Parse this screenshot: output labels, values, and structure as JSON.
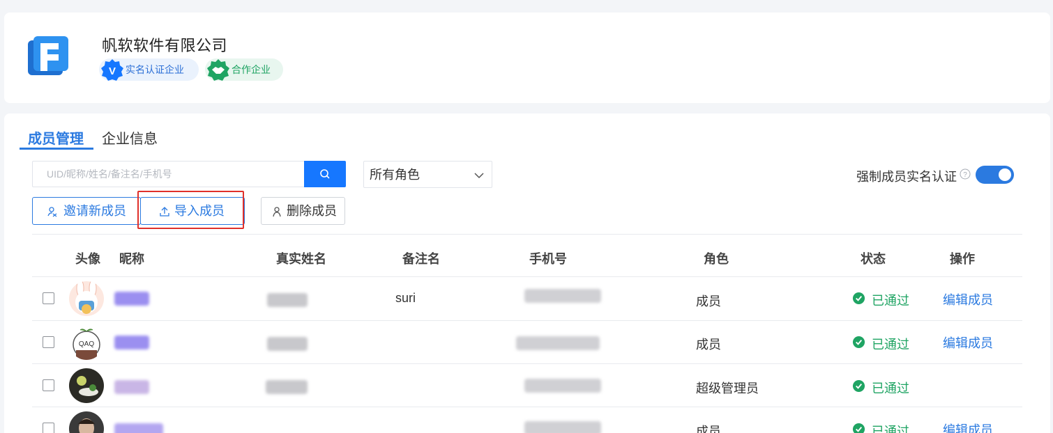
{
  "company": {
    "name": "帆软软件有限公司",
    "badges": {
      "verified": "实名认证企业",
      "partner": "合作企业"
    },
    "badge_icon_text": "V"
  },
  "tabs": {
    "members": "成员管理",
    "info": "企业信息"
  },
  "search": {
    "placeholder": "UID/昵称/姓名/备注名/手机号"
  },
  "role_filter": {
    "selected": "所有角色"
  },
  "force_verify": {
    "label": "强制成员实名认证",
    "enabled": true
  },
  "actions": {
    "invite": "邀请新成员",
    "import": "导入成员",
    "delete": "删除成员"
  },
  "table": {
    "headers": {
      "avatar": "头像",
      "nickname": "昵称",
      "realname": "真实姓名",
      "remark": "备注名",
      "phone": "手机号",
      "role": "角色",
      "status": "状态",
      "ops": "操作"
    },
    "rows": [
      {
        "remark": "suri",
        "role": "成员",
        "status": "已通过",
        "op": "编辑成员"
      },
      {
        "remark": "",
        "role": "成员",
        "status": "已通过",
        "op": "编辑成员"
      },
      {
        "remark": "",
        "role": "超级管理员",
        "status": "已通过",
        "op": ""
      },
      {
        "remark": "",
        "role": "成员",
        "status": "已通过",
        "op": "编辑成员"
      }
    ]
  },
  "colors": {
    "primary": "#2b7ae0",
    "success": "#1fa463",
    "highlight": "#e0302a"
  }
}
